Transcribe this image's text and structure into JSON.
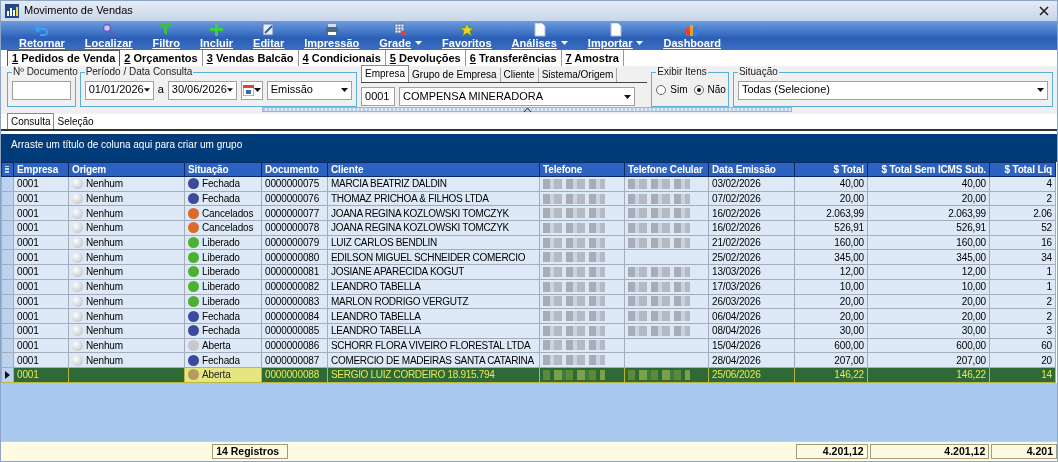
{
  "window": {
    "title": "Movimento de Vendas"
  },
  "toolbar": [
    {
      "label": "Retornar",
      "kind": "undo",
      "has_menu": false
    },
    {
      "label": "Localizar",
      "kind": "search",
      "has_menu": false
    },
    {
      "label": "Filtro",
      "kind": "filter",
      "has_menu": false
    },
    {
      "label": "Incluir",
      "kind": "plus",
      "has_menu": false
    },
    {
      "label": "Editar",
      "kind": "edit",
      "has_menu": false
    },
    {
      "label": "Impressão",
      "kind": "print",
      "has_menu": false
    },
    {
      "label": "Grade",
      "kind": "grid",
      "has_menu": true
    },
    {
      "label": "Favoritos",
      "kind": "star",
      "has_menu": false
    },
    {
      "label": "Análises",
      "kind": "page",
      "has_menu": true
    },
    {
      "label": "Importar",
      "kind": "page",
      "has_menu": true
    },
    {
      "label": "Dashboard",
      "kind": "chart",
      "has_menu": false
    }
  ],
  "tabs": [
    {
      "key": "1",
      "label": "Pedidos de Venda",
      "selected": true
    },
    {
      "key": "2",
      "label": "Orçamentos",
      "selected": false
    },
    {
      "key": "3",
      "label": "Vendas Balcão",
      "selected": false
    },
    {
      "key": "4",
      "label": "Condicionais",
      "selected": false
    },
    {
      "key": "5",
      "label": "Devoluções",
      "selected": false
    },
    {
      "key": "6",
      "label": "Transferências",
      "selected": false
    },
    {
      "key": "7",
      "label": "Amostra",
      "selected": false
    }
  ],
  "documento": {
    "legend": "Nº Documento"
  },
  "periodo": {
    "legend": "Período / Data Consulta",
    "from": "01/01/2026",
    "separator": "a",
    "to": "30/06/2026",
    "date_type": "Emissão"
  },
  "empresa_panel": {
    "tabs": [
      {
        "label": "Empresa",
        "selected": true
      },
      {
        "label": "Grupo de Empresa",
        "selected": false
      },
      {
        "label": "Cliente",
        "selected": false
      },
      {
        "label": "Sistema/Origem",
        "selected": false
      }
    ],
    "code": "0001",
    "name": "COMPENSA MINERADORA"
  },
  "exibir_itens": {
    "legend": "Exibir Itens",
    "options": [
      {
        "label": "Sim",
        "selected": false
      },
      {
        "label": "Não",
        "selected": true
      }
    ]
  },
  "situacao": {
    "legend": "Situação",
    "value": "Todas (Selecione)"
  },
  "view_tabs": [
    {
      "label": "Consulta",
      "selected": true
    },
    {
      "label": "Seleção",
      "selected": false
    }
  ],
  "group_panel": {
    "hint": "Arraste um título de coluna aqui para criar um grupo"
  },
  "table": {
    "columns": [
      "Empresa",
      "Origem",
      "Situação",
      "Documento",
      "Cliente",
      "Telefone",
      "Telefone Celular",
      "Data Emissão",
      "$ Total",
      "$ Total Sem ICMS Sub.",
      "$ Total Líq"
    ],
    "rows": [
      {
        "empresa": "0001",
        "origem": "Nenhum",
        "situacao": "Fechada",
        "color": "#3b4a9c",
        "documento": "0000000075",
        "cliente": "MARCIA BEATRIZ DALDIN",
        "phone_blurred": true,
        "mobile_blurred": true,
        "data_emissao": "03/02/2026",
        "total": "40,00",
        "total_sem_icms": "40,00",
        "total_liq": "4",
        "selected": false
      },
      {
        "empresa": "0001",
        "origem": "Nenhum",
        "situacao": "Fechada",
        "color": "#3b4a9c",
        "documento": "0000000076",
        "cliente": "THOMAZ PRICHOA & FILHOS LTDA",
        "phone_blurred": true,
        "mobile_blurred": true,
        "data_emissao": "07/02/2026",
        "total": "20,00",
        "total_sem_icms": "20,00",
        "total_liq": "2",
        "selected": false
      },
      {
        "empresa": "0001",
        "origem": "Nenhum",
        "situacao": "Cancelados",
        "color": "#e0692a",
        "documento": "0000000077",
        "cliente": "JOANA REGINA KOZLOWSKI TOMCZYK",
        "phone_blurred": true,
        "mobile_blurred": true,
        "data_emissao": "16/02/2026",
        "total": "2.063,99",
        "total_sem_icms": "2.063,99",
        "total_liq": "2.06",
        "selected": false
      },
      {
        "empresa": "0001",
        "origem": "Nenhum",
        "situacao": "Cancelados",
        "color": "#e0692a",
        "documento": "0000000078",
        "cliente": "JOANA REGINA KOZLOWSKI TOMCZYK",
        "phone_blurred": true,
        "mobile_blurred": true,
        "data_emissao": "16/02/2026",
        "total": "526,91",
        "total_sem_icms": "526,91",
        "total_liq": "52",
        "selected": false
      },
      {
        "empresa": "0001",
        "origem": "Nenhum",
        "situacao": "Liberado",
        "color": "#4cb030",
        "documento": "0000000079",
        "cliente": "LUIZ CARLOS BENDLIN",
        "phone_blurred": true,
        "mobile_blurred": true,
        "data_emissao": "21/02/2026",
        "total": "160,00",
        "total_sem_icms": "160,00",
        "total_liq": "16",
        "selected": false
      },
      {
        "empresa": "0001",
        "origem": "Nenhum",
        "situacao": "Liberado",
        "color": "#4cb030",
        "documento": "0000000080",
        "cliente": "EDILSON MIGUEL SCHNEIDER COMERCIO",
        "phone_blurred": true,
        "mobile_blurred": false,
        "data_emissao": "25/02/2026",
        "total": "345,00",
        "total_sem_icms": "345,00",
        "total_liq": "34",
        "selected": false
      },
      {
        "empresa": "0001",
        "origem": "Nenhum",
        "situacao": "Liberado",
        "color": "#4cb030",
        "documento": "0000000081",
        "cliente": "JOSIANE APARECIDA KOGUT",
        "phone_blurred": true,
        "mobile_blurred": true,
        "data_emissao": "13/03/2026",
        "total": "12,00",
        "total_sem_icms": "12,00",
        "total_liq": "1",
        "selected": false
      },
      {
        "empresa": "0001",
        "origem": "Nenhum",
        "situacao": "Liberado",
        "color": "#4cb030",
        "documento": "0000000082",
        "cliente": "LEANDRO TABELLA",
        "phone_blurred": true,
        "mobile_blurred": true,
        "data_emissao": "17/03/2026",
        "total": "10,00",
        "total_sem_icms": "10,00",
        "total_liq": "1",
        "selected": false
      },
      {
        "empresa": "0001",
        "origem": "Nenhum",
        "situacao": "Liberado",
        "color": "#4cb030",
        "documento": "0000000083",
        "cliente": "MARLON RODRIGO VERGUTZ",
        "phone_blurred": true,
        "mobile_blurred": true,
        "data_emissao": "26/03/2026",
        "total": "20,00",
        "total_sem_icms": "20,00",
        "total_liq": "2",
        "selected": false
      },
      {
        "empresa": "0001",
        "origem": "Nenhum",
        "situacao": "Fechada",
        "color": "#3b4a9c",
        "documento": "0000000084",
        "cliente": "LEANDRO TABELLA",
        "phone_blurred": true,
        "mobile_blurred": true,
        "data_emissao": "06/04/2026",
        "total": "20,00",
        "total_sem_icms": "20,00",
        "total_liq": "2",
        "selected": false
      },
      {
        "empresa": "0001",
        "origem": "Nenhum",
        "situacao": "Fechada",
        "color": "#3b4a9c",
        "documento": "0000000085",
        "cliente": "LEANDRO TABELLA",
        "phone_blurred": true,
        "mobile_blurred": true,
        "data_emissao": "08/04/2026",
        "total": "30,00",
        "total_sem_icms": "30,00",
        "total_liq": "3",
        "selected": false
      },
      {
        "empresa": "0001",
        "origem": "Nenhum",
        "situacao": "Aberta",
        "color": "#c8c8cc",
        "documento": "0000000086",
        "cliente": "SCHORR FLORA VIVEIRO FLORESTAL LTDA",
        "phone_blurred": true,
        "mobile_blurred": false,
        "data_emissao": "15/04/2026",
        "total": "600,00",
        "total_sem_icms": "600,00",
        "total_liq": "60",
        "selected": false
      },
      {
        "empresa": "0001",
        "origem": "Nenhum",
        "situacao": "Fechada",
        "color": "#3b4a9c",
        "documento": "0000000087",
        "cliente": "COMERCIO DE MADEIRAS SANTA CATARINA",
        "phone_blurred": true,
        "mobile_blurred": false,
        "data_emissao": "28/04/2026",
        "total": "207,00",
        "total_sem_icms": "207,00",
        "total_liq": "20",
        "selected": false
      },
      {
        "empresa": "0001",
        "situacao": "Aberta",
        "color": "#b89a60",
        "documento": "0000000088",
        "cliente": "SERGIO LUIZ CORDEIRO 18.915.794",
        "phone_blurred": true,
        "mobile_blurred": true,
        "data_emissao": "25/06/2026",
        "total": "146,22",
        "total_sem_icms": "146,22",
        "total_liq": "14",
        "selected": true
      }
    ]
  },
  "footer": {
    "count": "14 Registros",
    "totals": [
      "4.201,12",
      "4.201,12",
      "4.201"
    ]
  }
}
